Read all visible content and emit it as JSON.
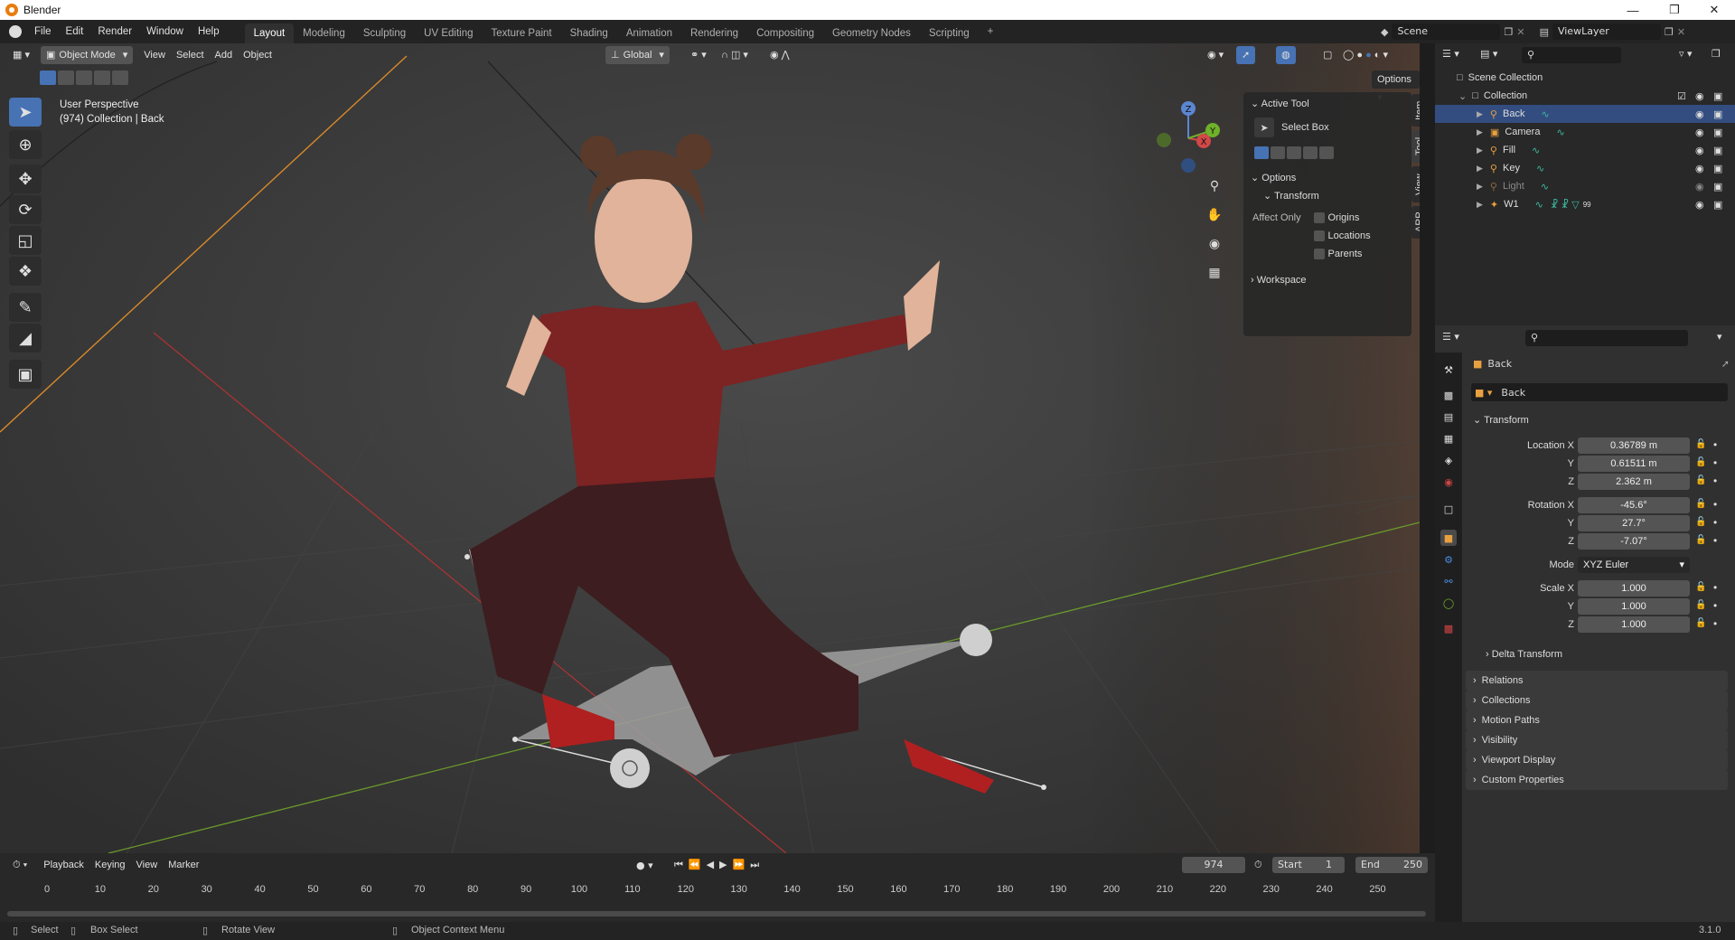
{
  "window": {
    "title": "Blender"
  },
  "menu": {
    "items": [
      "File",
      "Edit",
      "Render",
      "Window",
      "Help"
    ],
    "workspaces": [
      "Layout",
      "Modeling",
      "Sculpting",
      "UV Editing",
      "Texture Paint",
      "Shading",
      "Animation",
      "Rendering",
      "Compositing",
      "Geometry Nodes",
      "Scripting"
    ],
    "active_workspace": "Layout",
    "add_tab": "+",
    "scene": "Scene",
    "view_layer": "ViewLayer"
  },
  "viewport": {
    "mode": "Object Mode",
    "menus": [
      "View",
      "Select",
      "Add",
      "Object"
    ],
    "orientation": "Global",
    "options": "Options",
    "overlay_title": "User Perspective",
    "overlay_sub": "(974) Collection | Back",
    "gizmo": {
      "x": "X",
      "y": "Y",
      "z": "Z"
    }
  },
  "tool_panel": {
    "active_tool_header": "Active Tool",
    "tool_name": "Select Box",
    "options_header": "Options",
    "transform_header": "Transform",
    "affect_only": "Affect Only",
    "checks": [
      "Origins",
      "Locations",
      "Parents"
    ],
    "workspace_header": "Workspace",
    "side_tabs": [
      "Item",
      "Tool",
      "View",
      "ARP"
    ]
  },
  "outliner": {
    "root": "Scene Collection",
    "collection": "Collection",
    "items": [
      {
        "name": "Back",
        "selected": true
      },
      {
        "name": "Camera",
        "selected": false
      },
      {
        "name": "Fill",
        "selected": false
      },
      {
        "name": "Key",
        "selected": false
      },
      {
        "name": "Light",
        "selected": false,
        "dim": true
      },
      {
        "name": "W1",
        "selected": false
      }
    ],
    "w1_badge": "99"
  },
  "properties": {
    "object_name": "Back",
    "data_name": "Back",
    "transform_header": "Transform",
    "location": {
      "label": "Location X",
      "x": "0.36789 m",
      "y": "0.61511 m",
      "z": "2.362 m"
    },
    "rotation": {
      "label": "Rotation X",
      "x": "-45.6°",
      "y": "27.7°",
      "z": "-7.07°"
    },
    "mode_label": "Mode",
    "mode_value": "XYZ Euler",
    "scale": {
      "label": "Scale X",
      "x": "1.000",
      "y": "1.000",
      "z": "1.000"
    },
    "axis_y": "Y",
    "axis_z": "Z",
    "delta": "Delta Transform",
    "sections": [
      "Relations",
      "Collections",
      "Motion Paths",
      "Visibility",
      "Viewport Display",
      "Custom Properties"
    ]
  },
  "timeline": {
    "menus": [
      "Playback",
      "Keying",
      "View",
      "Marker"
    ],
    "current_frame": "974",
    "start_label": "Start",
    "start_value": "1",
    "end_label": "End",
    "end_value": "250",
    "ticks": [
      "0",
      "10",
      "20",
      "30",
      "40",
      "50",
      "60",
      "70",
      "80",
      "90",
      "100",
      "110",
      "120",
      "130",
      "140",
      "150",
      "160",
      "170",
      "180",
      "190",
      "200",
      "210",
      "220",
      "230",
      "240",
      "250"
    ]
  },
  "statusbar": {
    "select": "Select",
    "box_select": "Box Select",
    "rotate_view": "Rotate View",
    "context_menu": "Object Context Menu",
    "version": "3.1.0"
  }
}
